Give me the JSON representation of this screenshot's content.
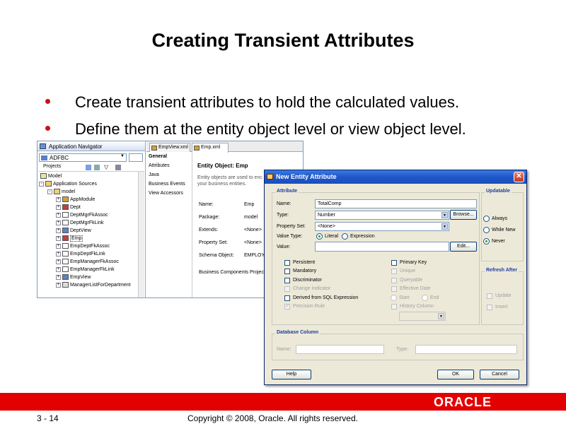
{
  "slide": {
    "title": "Creating Transient Attributes",
    "bullets": [
      "Create transient attributes to hold the calculated values.",
      "Define them at the entity object level or view object level."
    ],
    "page_number": "3 - 14",
    "copyright": "Copyright © 2008, Oracle. All rights reserved.",
    "logo": "ORACLE"
  },
  "ide": {
    "panel_title": "Application Navigator",
    "app_combo": "ADFBC",
    "projects_label": "Projects",
    "tree": [
      "Model",
      "Application Sources",
      "model",
      "AppModule",
      "Dept",
      "DeptMgrFkAssoc",
      "DeptMgrFkLink",
      "DeptView",
      "Emp",
      "EmpDeptFkAssoc",
      "EmpDeptFkLink",
      "EmpManagerFkAssoc",
      "EmpManagerFkLink",
      "EmpView",
      "ManagerListForDepartment"
    ],
    "tabs": [
      "EmpView.xml",
      "Emp.xml"
    ],
    "nav": [
      "General",
      "Attributes",
      "Java",
      "Business Events",
      "View Accessors"
    ],
    "entity_heading": "Entity Object: Emp",
    "entity_desc": [
      "Entity objects are used to enc",
      "your business entities."
    ],
    "props": [
      {
        "label": "Name:",
        "value": "Emp"
      },
      {
        "label": "Package:",
        "value": "model"
      },
      {
        "label": "Extends:",
        "value": "<None>"
      },
      {
        "label": "Property Set:",
        "value": "<None>"
      },
      {
        "label": "Schema Object:",
        "value": "EMPLOYE"
      }
    ],
    "bc_project": "Business Components Project"
  },
  "dialog": {
    "title": "New Entity Attribute",
    "attribute_group": "Attribute",
    "name_label": "Name:",
    "name_value": "TotalComp",
    "type_label": "Type:",
    "type_value": "Number",
    "browse": "Browse...",
    "property_set_label": "Property Set:",
    "property_set_value": "<None>",
    "value_type_label": "Value Type:",
    "literal": "Literal",
    "expression": "Expression",
    "value_label": "Value:",
    "edit": "Edit...",
    "checks_left": [
      "Persistent",
      "Mandatory",
      "Discriminator",
      "Change Indicator",
      "Derived from SQL Expression",
      "Precision Rule"
    ],
    "checks_right": [
      "Primary Key",
      "Unique",
      "Queryable",
      "Effective Date",
      "Start",
      "End",
      "History Column"
    ],
    "updatable_group": "Updatable",
    "updatable_options": [
      "Always",
      "While New",
      "Never"
    ],
    "refresh_group": "Refresh After",
    "refresh_options": [
      "Update",
      "Insert"
    ],
    "db_group": "Database Column",
    "db_name_label": "Name:",
    "db_type_label": "Type:",
    "help": "Help",
    "ok": "OK",
    "cancel": "Cancel"
  }
}
